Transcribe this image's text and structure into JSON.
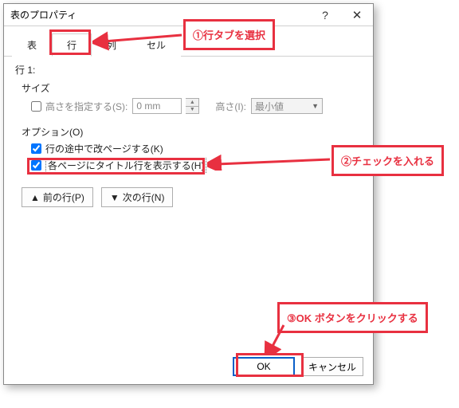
{
  "dialog": {
    "title": "表のプロパティ"
  },
  "tabs": {
    "table": "表",
    "row": "行",
    "column": "列",
    "cell": "セル"
  },
  "rowGroup": {
    "label": "行 1:",
    "size": "サイズ",
    "specifyHeight": "高さを指定する(S):",
    "heightValue": "0 mm",
    "heightIs": "高さ(I):",
    "minValue": "最小値",
    "optionsLabel": "オプション(O)",
    "breakAcross": "行の途中で改ページする(K)",
    "repeatHeader": "各ページにタイトル行を表示する(H)"
  },
  "nav": {
    "prev": "前の行(P)",
    "next": "次の行(N)"
  },
  "footer": {
    "ok": "OK",
    "cancel": "キャンセル"
  },
  "callouts": {
    "c1": "①行タブを選択",
    "c2": "②チェックを入れる",
    "c3": "③OK ボタンをクリックする"
  }
}
